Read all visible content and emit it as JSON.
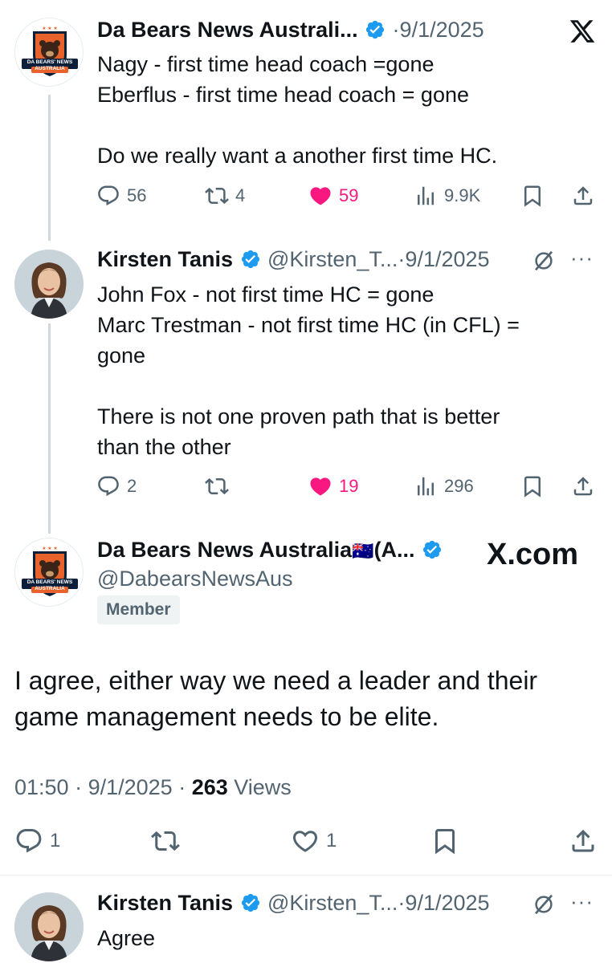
{
  "tweet1": {
    "name": "Da Bears News Australi...",
    "date": "9/1/2025",
    "lines": [
      "Nagy - first time head coach =gone",
      "Eberflus - first time head coach = gone",
      "",
      "Do we really want a another first time HC."
    ],
    "replies": "56",
    "retweets": "4",
    "likes": "59",
    "views": "9.9K",
    "avatar_text": "DA BEARS' NEWS AUSTRALIA"
  },
  "tweet2": {
    "name": "Kirsten Tanis",
    "handle": "@Kirsten_T...",
    "date": "9/1/2025",
    "lines": [
      "John Fox - not first time HC = gone",
      "Marc Trestman - not first time HC (in CFL) =",
      "gone",
      "",
      "There is not one proven path that is better",
      "than the other"
    ],
    "replies": "2",
    "likes": "19",
    "views": "296"
  },
  "main_tweet": {
    "name": "Da Bears News Australia",
    "flag": "🇦🇺",
    "name_suffix": "(A...",
    "handle": "@DabearsNewsAus",
    "badge": "Member",
    "watermark": "X.com",
    "text_lines": [
      "I agree, either way we need a leader and their",
      "game management needs to be elite."
    ],
    "time": "01:50",
    "date": "9/1/2025",
    "views_count": "263",
    "views_label": "Views",
    "replies": "1",
    "likes": "1",
    "avatar_text": "DA BEARS' NEWS AUSTRALIA"
  },
  "tweet4": {
    "name": "Kirsten Tanis",
    "handle": "@Kirsten_T...",
    "date": "9/1/2025",
    "text": "Agree"
  },
  "colors": {
    "verified": "#1d9bf0",
    "like": "#f91880",
    "muted": "#536471",
    "thread_line": "#cfd9de"
  }
}
